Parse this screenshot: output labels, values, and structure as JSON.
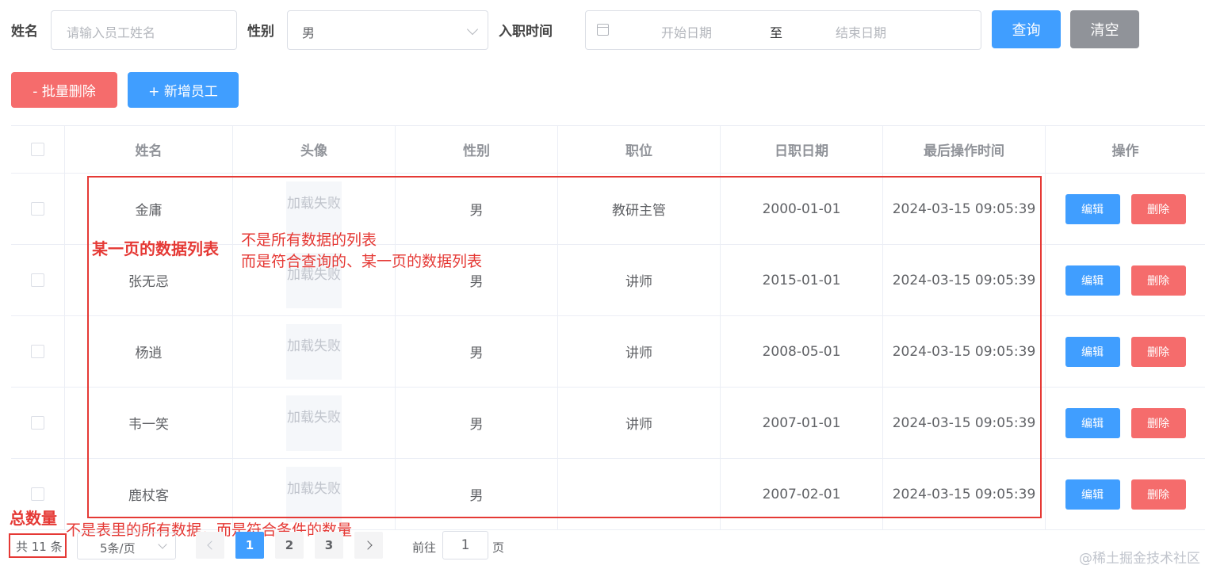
{
  "search": {
    "name_label": "姓名",
    "name_placeholder": "请输入员工姓名",
    "gender_label": "性别",
    "gender_value": "男",
    "entry_label": "入职时间",
    "start_placeholder": "开始日期",
    "range_sep": "至",
    "end_placeholder": "结束日期",
    "query_button": "查询",
    "clear_button": "清空"
  },
  "actions": {
    "batch_delete": "- 批量删除",
    "add_employee": "+ 新增员工"
  },
  "table": {
    "headers": [
      "姓名",
      "头像",
      "性别",
      "职位",
      "日职日期",
      "最后操作时间",
      "操作"
    ],
    "avatar_failed": "加载失败",
    "edit_label": "编辑",
    "delete_label": "删除",
    "rows": [
      {
        "name": "金庸",
        "gender": "男",
        "position": "教研主管",
        "entry_date": "2000-01-01",
        "updated": "2024-03-15 09:05:39"
      },
      {
        "name": "张无忌",
        "gender": "男",
        "position": "讲师",
        "entry_date": "2015-01-01",
        "updated": "2024-03-15 09:05:39"
      },
      {
        "name": "杨逍",
        "gender": "男",
        "position": "讲师",
        "entry_date": "2008-05-01",
        "updated": "2024-03-15 09:05:39"
      },
      {
        "name": "韦一笑",
        "gender": "男",
        "position": "讲师",
        "entry_date": "2007-01-01",
        "updated": "2024-03-15 09:05:39"
      },
      {
        "name": "鹿杖客",
        "gender": "男",
        "position": "",
        "entry_date": "2007-02-01",
        "updated": "2024-03-15 09:05:39"
      }
    ]
  },
  "annotations": {
    "page_list_title": "某一页的数据列表",
    "page_list_line1": "不是所有数据的列表",
    "page_list_line2": "而是符合查询的、某一页的数据列表",
    "total_title": "总数量",
    "total_desc": "不是表里的所有数据，而是符合条件的数量"
  },
  "pagination": {
    "total": "共 11 条",
    "page_size": "5条/页",
    "pages": [
      "1",
      "2",
      "3"
    ],
    "current_page": "1",
    "goto_prefix": "前往",
    "goto_value": "1",
    "goto_suffix": "页"
  },
  "watermark": "@稀土掘金技术社区",
  "colors": {
    "primary": "#409eff",
    "danger": "#f56c6c",
    "gray": "#909399",
    "annotation": "#e53935"
  }
}
